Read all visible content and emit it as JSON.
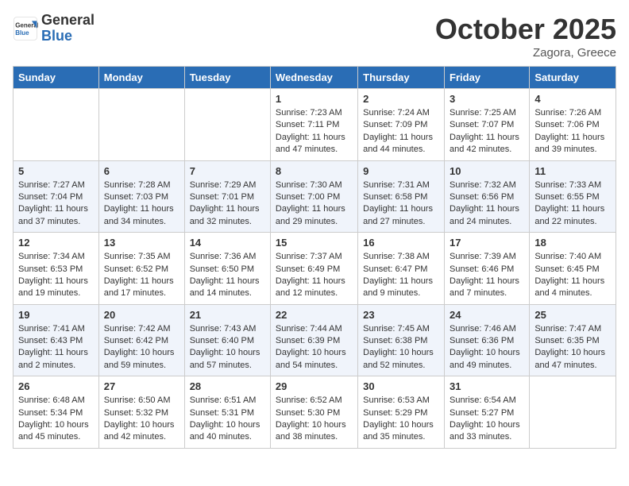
{
  "header": {
    "logo_general": "General",
    "logo_blue": "Blue",
    "month_title": "October 2025",
    "location": "Zagora, Greece"
  },
  "days_of_week": [
    "Sunday",
    "Monday",
    "Tuesday",
    "Wednesday",
    "Thursday",
    "Friday",
    "Saturday"
  ],
  "weeks": [
    [
      {
        "day": "",
        "content": ""
      },
      {
        "day": "",
        "content": ""
      },
      {
        "day": "",
        "content": ""
      },
      {
        "day": "1",
        "content": "Sunrise: 7:23 AM\nSunset: 7:11 PM\nDaylight: 11 hours and 47 minutes."
      },
      {
        "day": "2",
        "content": "Sunrise: 7:24 AM\nSunset: 7:09 PM\nDaylight: 11 hours and 44 minutes."
      },
      {
        "day": "3",
        "content": "Sunrise: 7:25 AM\nSunset: 7:07 PM\nDaylight: 11 hours and 42 minutes."
      },
      {
        "day": "4",
        "content": "Sunrise: 7:26 AM\nSunset: 7:06 PM\nDaylight: 11 hours and 39 minutes."
      }
    ],
    [
      {
        "day": "5",
        "content": "Sunrise: 7:27 AM\nSunset: 7:04 PM\nDaylight: 11 hours and 37 minutes."
      },
      {
        "day": "6",
        "content": "Sunrise: 7:28 AM\nSunset: 7:03 PM\nDaylight: 11 hours and 34 minutes."
      },
      {
        "day": "7",
        "content": "Sunrise: 7:29 AM\nSunset: 7:01 PM\nDaylight: 11 hours and 32 minutes."
      },
      {
        "day": "8",
        "content": "Sunrise: 7:30 AM\nSunset: 7:00 PM\nDaylight: 11 hours and 29 minutes."
      },
      {
        "day": "9",
        "content": "Sunrise: 7:31 AM\nSunset: 6:58 PM\nDaylight: 11 hours and 27 minutes."
      },
      {
        "day": "10",
        "content": "Sunrise: 7:32 AM\nSunset: 6:56 PM\nDaylight: 11 hours and 24 minutes."
      },
      {
        "day": "11",
        "content": "Sunrise: 7:33 AM\nSunset: 6:55 PM\nDaylight: 11 hours and 22 minutes."
      }
    ],
    [
      {
        "day": "12",
        "content": "Sunrise: 7:34 AM\nSunset: 6:53 PM\nDaylight: 11 hours and 19 minutes."
      },
      {
        "day": "13",
        "content": "Sunrise: 7:35 AM\nSunset: 6:52 PM\nDaylight: 11 hours and 17 minutes."
      },
      {
        "day": "14",
        "content": "Sunrise: 7:36 AM\nSunset: 6:50 PM\nDaylight: 11 hours and 14 minutes."
      },
      {
        "day": "15",
        "content": "Sunrise: 7:37 AM\nSunset: 6:49 PM\nDaylight: 11 hours and 12 minutes."
      },
      {
        "day": "16",
        "content": "Sunrise: 7:38 AM\nSunset: 6:47 PM\nDaylight: 11 hours and 9 minutes."
      },
      {
        "day": "17",
        "content": "Sunrise: 7:39 AM\nSunset: 6:46 PM\nDaylight: 11 hours and 7 minutes."
      },
      {
        "day": "18",
        "content": "Sunrise: 7:40 AM\nSunset: 6:45 PM\nDaylight: 11 hours and 4 minutes."
      }
    ],
    [
      {
        "day": "19",
        "content": "Sunrise: 7:41 AM\nSunset: 6:43 PM\nDaylight: 11 hours and 2 minutes."
      },
      {
        "day": "20",
        "content": "Sunrise: 7:42 AM\nSunset: 6:42 PM\nDaylight: 10 hours and 59 minutes."
      },
      {
        "day": "21",
        "content": "Sunrise: 7:43 AM\nSunset: 6:40 PM\nDaylight: 10 hours and 57 minutes."
      },
      {
        "day": "22",
        "content": "Sunrise: 7:44 AM\nSunset: 6:39 PM\nDaylight: 10 hours and 54 minutes."
      },
      {
        "day": "23",
        "content": "Sunrise: 7:45 AM\nSunset: 6:38 PM\nDaylight: 10 hours and 52 minutes."
      },
      {
        "day": "24",
        "content": "Sunrise: 7:46 AM\nSunset: 6:36 PM\nDaylight: 10 hours and 49 minutes."
      },
      {
        "day": "25",
        "content": "Sunrise: 7:47 AM\nSunset: 6:35 PM\nDaylight: 10 hours and 47 minutes."
      }
    ],
    [
      {
        "day": "26",
        "content": "Sunrise: 6:48 AM\nSunset: 5:34 PM\nDaylight: 10 hours and 45 minutes."
      },
      {
        "day": "27",
        "content": "Sunrise: 6:50 AM\nSunset: 5:32 PM\nDaylight: 10 hours and 42 minutes."
      },
      {
        "day": "28",
        "content": "Sunrise: 6:51 AM\nSunset: 5:31 PM\nDaylight: 10 hours and 40 minutes."
      },
      {
        "day": "29",
        "content": "Sunrise: 6:52 AM\nSunset: 5:30 PM\nDaylight: 10 hours and 38 minutes."
      },
      {
        "day": "30",
        "content": "Sunrise: 6:53 AM\nSunset: 5:29 PM\nDaylight: 10 hours and 35 minutes."
      },
      {
        "day": "31",
        "content": "Sunrise: 6:54 AM\nSunset: 5:27 PM\nDaylight: 10 hours and 33 minutes."
      },
      {
        "day": "",
        "content": ""
      }
    ]
  ]
}
